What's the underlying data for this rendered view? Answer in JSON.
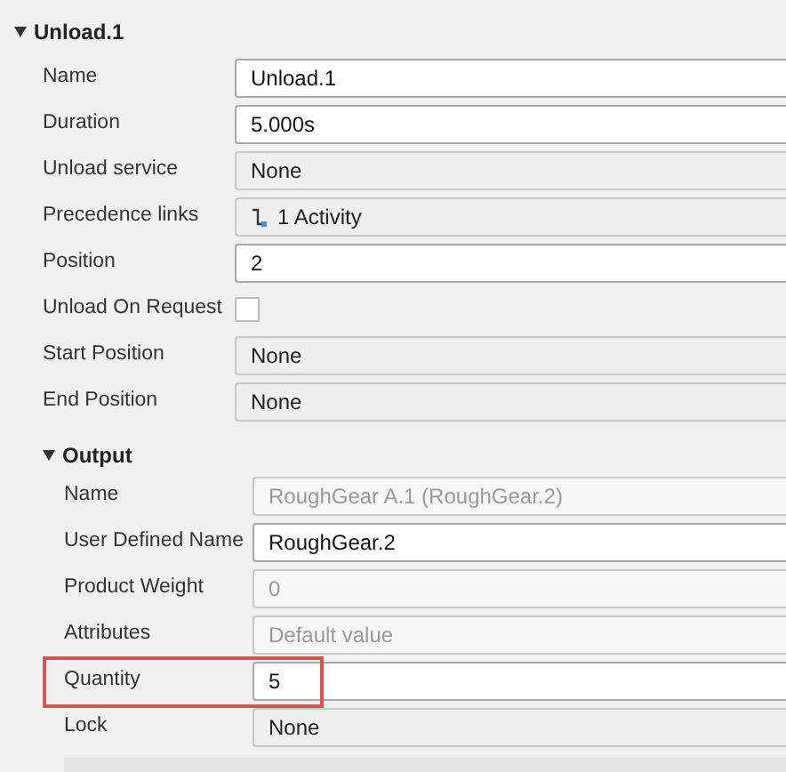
{
  "section": {
    "title": "Unload.1",
    "expanded": true,
    "properties": [
      {
        "label": "Name",
        "kind": "text",
        "value": "Unload.1"
      },
      {
        "label": "Duration",
        "kind": "text",
        "value": "5.000s"
      },
      {
        "label": "Unload service",
        "kind": "dropdown",
        "value": "None"
      },
      {
        "label": "Precedence links",
        "kind": "link",
        "value": "1 Activity"
      },
      {
        "label": "Position",
        "kind": "text",
        "value": "2"
      },
      {
        "label": "Unload On Request",
        "kind": "checkbox",
        "checked": false
      },
      {
        "label": "Start Position",
        "kind": "dropdown",
        "value": "None"
      },
      {
        "label": "End Position",
        "kind": "dropdown",
        "value": "None"
      }
    ],
    "subsection": {
      "title": "Output",
      "expanded": true,
      "properties": [
        {
          "label": "Name",
          "kind": "readonly",
          "value": "RoughGear A.1 (RoughGear.2)"
        },
        {
          "label": "User Defined Name",
          "kind": "text",
          "value": "RoughGear.2"
        },
        {
          "label": "Product Weight",
          "kind": "readonly",
          "value": "0"
        },
        {
          "label": "Attributes",
          "kind": "readonly",
          "value": "Default value"
        },
        {
          "label": "Quantity",
          "kind": "text",
          "value": "5",
          "highlighted": true
        },
        {
          "label": "Lock",
          "kind": "dropdown",
          "value": "None"
        }
      ]
    }
  }
}
